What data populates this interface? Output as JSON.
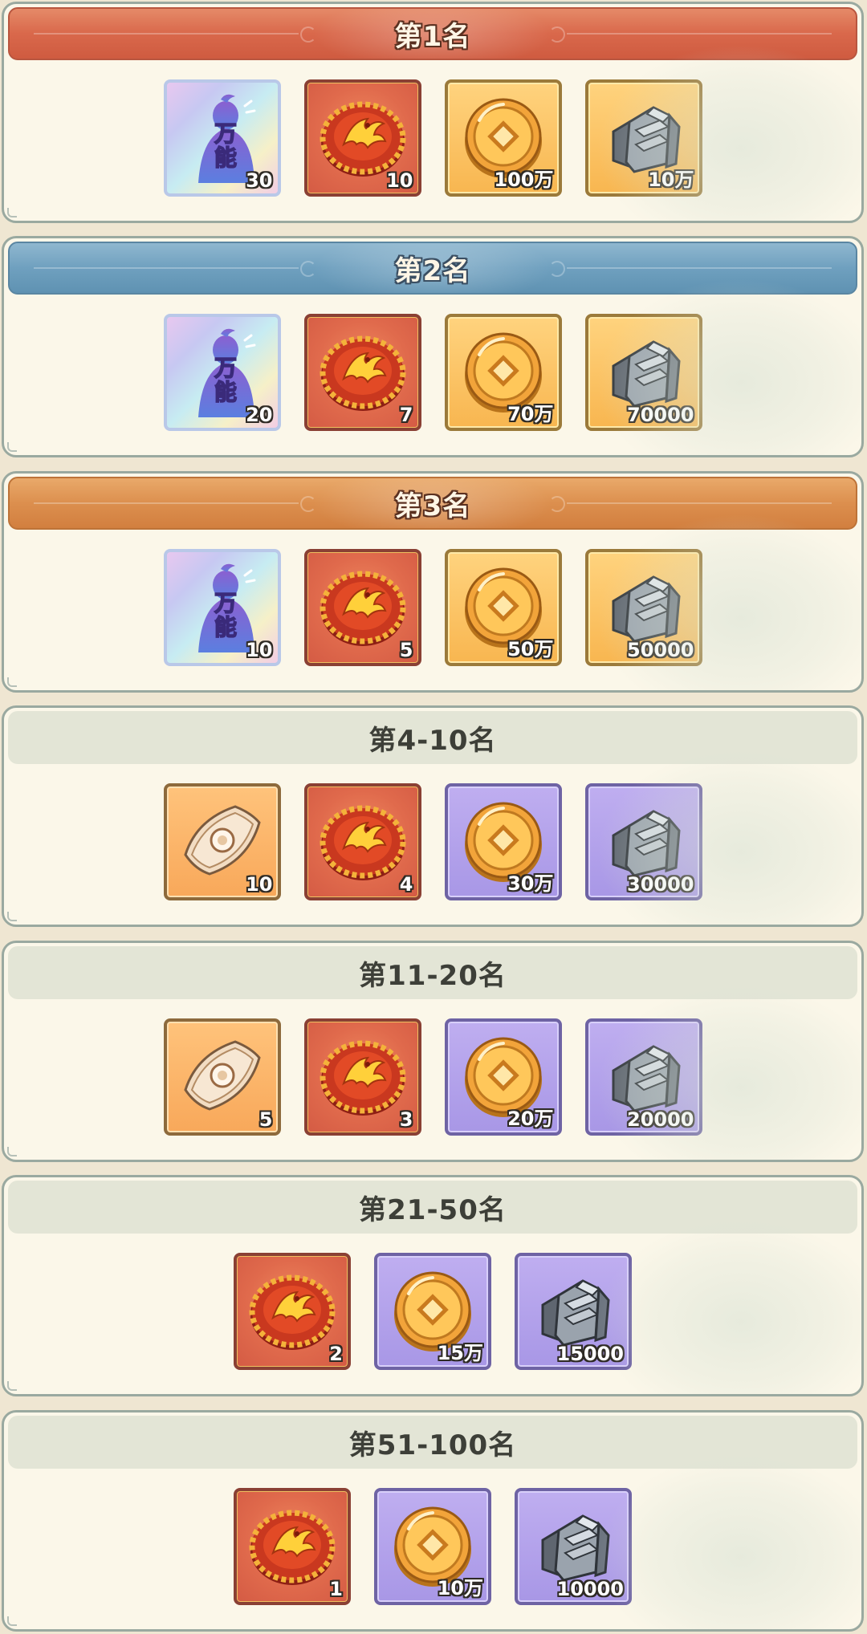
{
  "tiers": [
    {
      "title": "第1名",
      "style": "h1",
      "rewards": [
        {
          "type": "universal-fragment",
          "frame": "univ",
          "qty": "30",
          "icon_text": "万\n能"
        },
        {
          "type": "phoenix-medal",
          "frame": "red",
          "qty": "10"
        },
        {
          "type": "gold-coin",
          "frame": "gold",
          "qty": "100万"
        },
        {
          "type": "iron-ore",
          "frame": "gold",
          "qty": "10万"
        }
      ]
    },
    {
      "title": "第2名",
      "style": "h2",
      "rewards": [
        {
          "type": "universal-fragment",
          "frame": "univ",
          "qty": "20",
          "icon_text": "万\n能"
        },
        {
          "type": "phoenix-medal",
          "frame": "red",
          "qty": "7"
        },
        {
          "type": "gold-coin",
          "frame": "gold",
          "qty": "70万"
        },
        {
          "type": "iron-ore",
          "frame": "gold",
          "qty": "70000"
        }
      ]
    },
    {
      "title": "第3名",
      "style": "h3",
      "rewards": [
        {
          "type": "universal-fragment",
          "frame": "univ",
          "qty": "10",
          "icon_text": "万\n能"
        },
        {
          "type": "phoenix-medal",
          "frame": "red",
          "qty": "5"
        },
        {
          "type": "gold-coin",
          "frame": "gold",
          "qty": "50万"
        },
        {
          "type": "iron-ore",
          "frame": "gold",
          "qty": "50000"
        }
      ]
    },
    {
      "title": "第4-10名",
      "style": "plain",
      "rewards": [
        {
          "type": "talisman-scroll",
          "frame": "orange",
          "qty": "10"
        },
        {
          "type": "phoenix-medal",
          "frame": "red",
          "qty": "4"
        },
        {
          "type": "gold-coin",
          "frame": "purple",
          "qty": "30万"
        },
        {
          "type": "iron-ore",
          "frame": "purple",
          "qty": "30000"
        }
      ]
    },
    {
      "title": "第11-20名",
      "style": "plain",
      "rewards": [
        {
          "type": "talisman-scroll",
          "frame": "orange",
          "qty": "5"
        },
        {
          "type": "phoenix-medal",
          "frame": "red",
          "qty": "3"
        },
        {
          "type": "gold-coin",
          "frame": "purple",
          "qty": "20万"
        },
        {
          "type": "iron-ore",
          "frame": "purple",
          "qty": "20000"
        }
      ]
    },
    {
      "title": "第21-50名",
      "style": "plain",
      "rewards": [
        {
          "type": "phoenix-medal",
          "frame": "red",
          "qty": "2"
        },
        {
          "type": "gold-coin",
          "frame": "purple",
          "qty": "15万"
        },
        {
          "type": "iron-ore",
          "frame": "purple",
          "qty": "15000"
        }
      ]
    },
    {
      "title": "第51-100名",
      "style": "plain",
      "rewards": [
        {
          "type": "phoenix-medal",
          "frame": "red",
          "qty": "1"
        },
        {
          "type": "gold-coin",
          "frame": "purple",
          "qty": "10万"
        },
        {
          "type": "iron-ore",
          "frame": "purple",
          "qty": "10000"
        }
      ]
    }
  ],
  "colors": {
    "card_bg": "#fbf7e9",
    "card_border": "#9aa9a0",
    "tier1_header": "#d9684b",
    "tier2_header": "#6fa0bf",
    "tier3_header": "#dc8f4e",
    "plain_header": "#e3e5d6",
    "frame_red": "#e06a4c",
    "frame_gold": "#f8b650",
    "frame_purple": "#a897e6",
    "frame_orange": "#f8a85a"
  }
}
